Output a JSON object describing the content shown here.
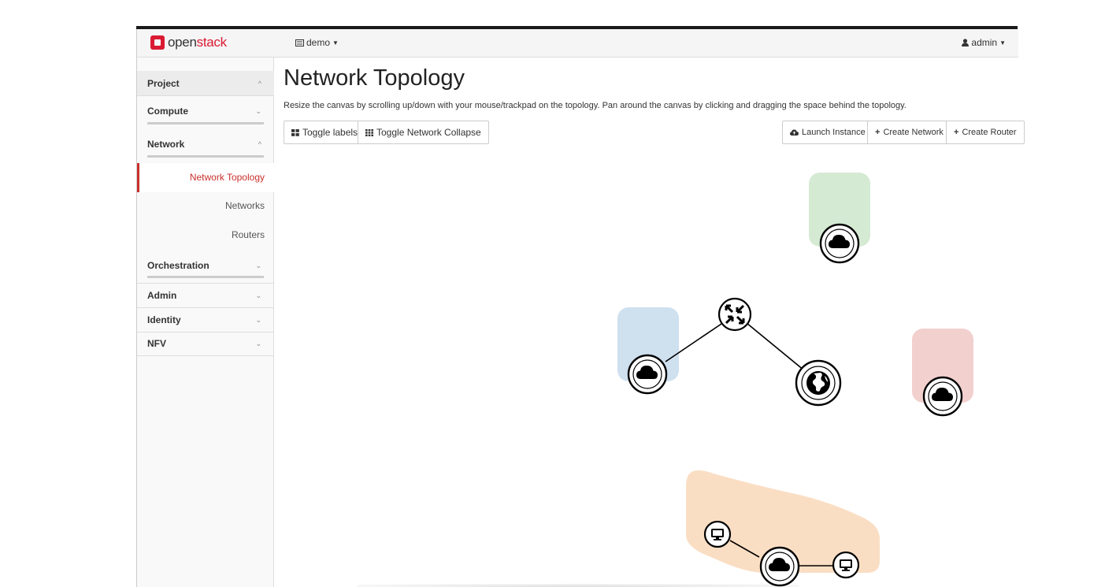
{
  "navbar": {
    "brand_open": "open",
    "brand_stack": "stack",
    "project": "demo",
    "user": "admin"
  },
  "sidebar": {
    "project": "Project",
    "compute": "Compute",
    "network": "Network",
    "network_items": [
      "Network Topology",
      "Networks",
      "Routers"
    ],
    "orchestration": "Orchestration",
    "admin": "Admin",
    "identity": "Identity",
    "nfv": "NFV"
  },
  "main": {
    "title": "Network Topology",
    "help": "Resize the canvas by scrolling up/down with your mouse/trackpad on the topology. Pan around the canvas by clicking and dragging the space behind the topology.",
    "toggle_labels": "Toggle labels",
    "toggle_collapse": "Toggle Network Collapse",
    "launch_instance": "Launch Instance",
    "create_network": "Create Network",
    "create_router": "Create Router"
  },
  "colors": {
    "accent": "#da1a32",
    "active": "#c9302c",
    "net_green": "#d5ead3",
    "net_blue": "#cfe0ef",
    "net_red": "#f2d0ce",
    "net_orange": "#fadec4"
  },
  "icons": {
    "network": "cloud-icon",
    "router": "router-icon",
    "external": "globe-icon",
    "instance": "desktop-icon"
  }
}
